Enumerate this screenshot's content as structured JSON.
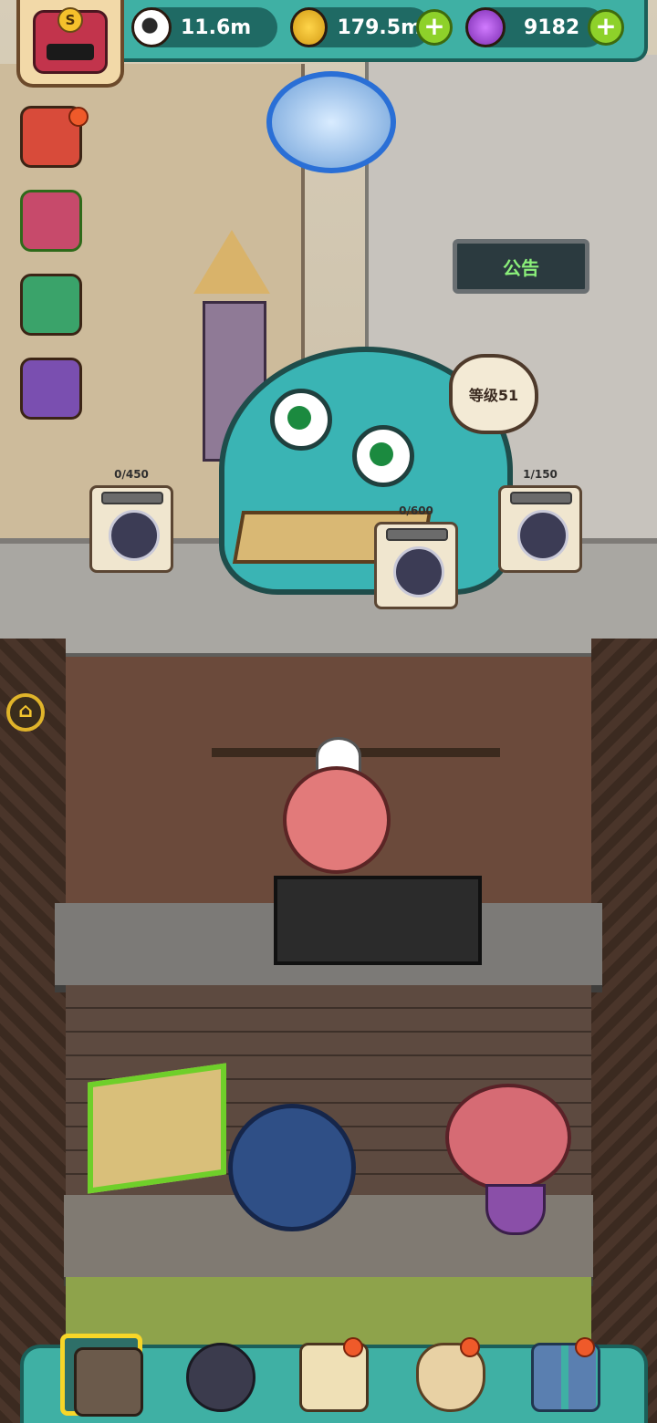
{
  "resources": {
    "eyeball": {
      "value": "11.6m",
      "icon": "eyeball-icon"
    },
    "coins": {
      "value": "179.5m",
      "icon": "coin-icon"
    },
    "potion": {
      "value": "9182",
      "icon": "potion-icon"
    }
  },
  "rank_badge": {
    "letter": "S"
  },
  "building_sign": {
    "label": "公告"
  },
  "shop": {
    "level_label": "等级51"
  },
  "orders": [
    {
      "progress": "0/450"
    },
    {
      "progress": "0/600"
    },
    {
      "progress": "1/150"
    }
  ],
  "colors": {
    "accent": "#3fb0a4",
    "plus_green": "#8ed12a",
    "notify_red": "#ef5a2a",
    "selected_gold": "#f7d628"
  },
  "side_menu": [
    {
      "name": "gift-box-red",
      "icon": "gift-icon",
      "notify": true
    },
    {
      "name": "gift-box-green",
      "icon": "gift-icon",
      "notify": false
    },
    {
      "name": "fruit-basket",
      "icon": "fruit-icon",
      "notify": false
    },
    {
      "name": "card-pack",
      "icon": "cards-icon",
      "notify": false
    }
  ],
  "bottom_nav": [
    {
      "name": "restaurant",
      "icon": "restaurant-icon",
      "selected": true,
      "notify": false
    },
    {
      "name": "monster",
      "icon": "monster-icon",
      "selected": false,
      "notify": false
    },
    {
      "name": "recipe-book",
      "icon": "book-icon",
      "selected": false,
      "notify": true
    },
    {
      "name": "bag",
      "icon": "bag-icon",
      "selected": false,
      "notify": true
    },
    {
      "name": "menu",
      "icon": "grid-icon",
      "selected": false,
      "notify": true
    }
  ]
}
